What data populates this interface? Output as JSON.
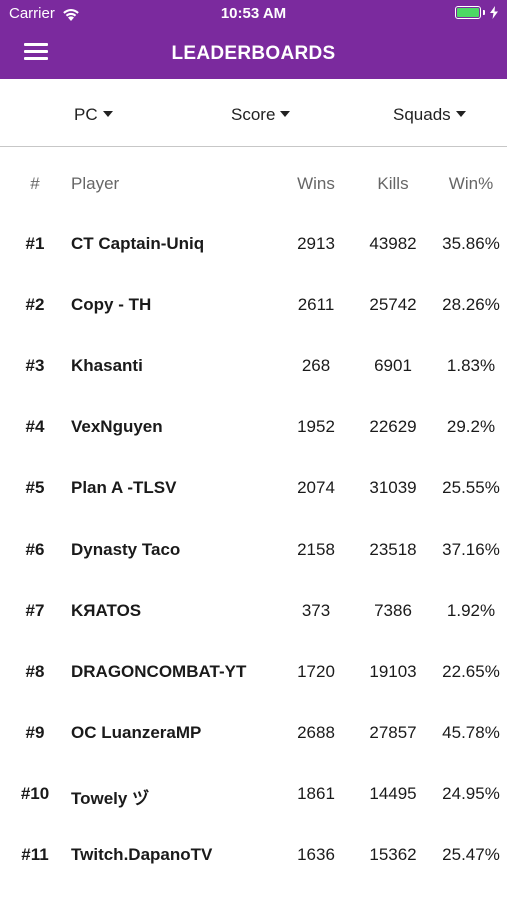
{
  "status_bar": {
    "carrier": "Carrier",
    "time": "10:53 AM",
    "battery_level": 1.0,
    "icons": [
      "wifi-icon",
      "battery-icon",
      "charging-bolt-icon"
    ]
  },
  "nav": {
    "title": "LEADERBOARDS",
    "menu_icon": "hamburger-menu-icon"
  },
  "colors": {
    "header_bg": "#7b2a9e",
    "header_text": "#ffffff",
    "battery_fill": "#4cd964"
  },
  "filters": {
    "platform": "PC",
    "stat": "Score",
    "mode": "Squads"
  },
  "table": {
    "headers": {
      "rank": "#",
      "player": "Player",
      "wins": "Wins",
      "kills": "Kills",
      "winpct": "Win%"
    },
    "rows": [
      {
        "rank": "#1",
        "player": "CT Captain-Uniq",
        "wins": "2913",
        "kills": "43982",
        "winpct": "35.86%"
      },
      {
        "rank": "#2",
        "player": "Copy - TH",
        "wins": "2611",
        "kills": "25742",
        "winpct": "28.26%"
      },
      {
        "rank": "#3",
        "player": "Khasanti",
        "wins": "268",
        "kills": "6901",
        "winpct": "1.83%"
      },
      {
        "rank": "#4",
        "player": "VexNguyen",
        "wins": "1952",
        "kills": "22629",
        "winpct": "29.2%"
      },
      {
        "rank": "#5",
        "player": "Plan A -TLSV",
        "wins": "2074",
        "kills": "31039",
        "winpct": "25.55%"
      },
      {
        "rank": "#6",
        "player": "Dynasty Taco",
        "wins": "2158",
        "kills": "23518",
        "winpct": "37.16%"
      },
      {
        "rank": "#7",
        "player": "KЯATOS",
        "wins": "373",
        "kills": "7386",
        "winpct": "1.92%"
      },
      {
        "rank": "#8",
        "player": "DRAGONCOMBAT-YT",
        "wins": "1720",
        "kills": "19103",
        "winpct": "22.65%"
      },
      {
        "rank": "#9",
        "player": "OC LuanzeraMP",
        "wins": "2688",
        "kills": "27857",
        "winpct": "45.78%"
      },
      {
        "rank": "#10",
        "player": "Towely ヅ",
        "wins": "1861",
        "kills": "14495",
        "winpct": "24.95%"
      },
      {
        "rank": "#11",
        "player": "Twitch.DapanoTV",
        "wins": "1636",
        "kills": "15362",
        "winpct": "25.47%"
      }
    ]
  }
}
